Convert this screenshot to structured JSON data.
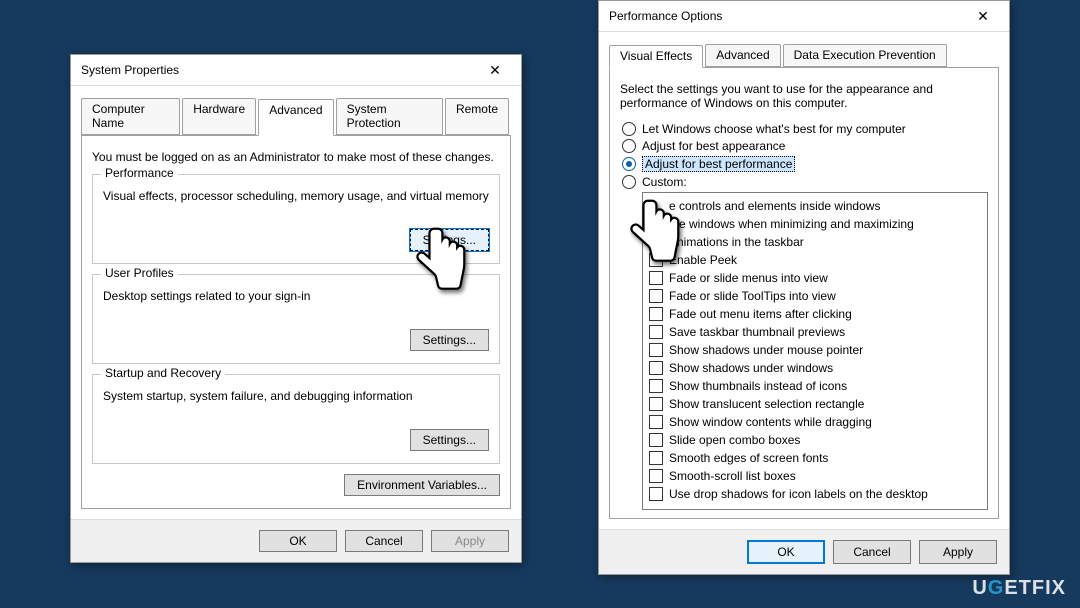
{
  "sysprops": {
    "title": "System Properties",
    "tabs": [
      "Computer Name",
      "Hardware",
      "Advanced",
      "System Protection",
      "Remote"
    ],
    "active_tab": 2,
    "instruction": "You must be logged on as an Administrator to make most of these changes.",
    "groups": {
      "performance": {
        "title": "Performance",
        "desc": "Visual effects, processor scheduling, memory usage, and virtual memory",
        "button": "Settings..."
      },
      "profiles": {
        "title": "User Profiles",
        "desc": "Desktop settings related to your sign-in",
        "button": "Settings..."
      },
      "startup": {
        "title": "Startup and Recovery",
        "desc": "System startup, system failure, and debugging information",
        "button": "Settings..."
      }
    },
    "env_button": "Environment Variables...",
    "ok": "OK",
    "cancel": "Cancel",
    "apply": "Apply"
  },
  "perfopts": {
    "title": "Performance Options",
    "tabs": [
      "Visual Effects",
      "Advanced",
      "Data Execution Prevention"
    ],
    "active_tab": 0,
    "instruction": "Select the settings you want to use for the appearance and performance of Windows on this computer.",
    "radios": [
      "Let Windows choose what's best for my computer",
      "Adjust for best appearance",
      "Adjust for best performance",
      "Custom:"
    ],
    "selected_radio": 2,
    "checks": [
      "Animate controls and elements inside windows",
      "Animate windows when minimizing and maximizing",
      "Animations in the taskbar",
      "Enable Peek",
      "Fade or slide menus into view",
      "Fade or slide ToolTips into view",
      "Fade out menu items after clicking",
      "Save taskbar thumbnail previews",
      "Show shadows under mouse pointer",
      "Show shadows under windows",
      "Show thumbnails instead of icons",
      "Show translucent selection rectangle",
      "Show window contents while dragging",
      "Slide open combo boxes",
      "Smooth edges of screen fonts",
      "Smooth-scroll list boxes",
      "Use drop shadows for icon labels on the desktop"
    ],
    "ok": "OK",
    "cancel": "Cancel",
    "apply": "Apply"
  },
  "watermark": {
    "u": "U",
    "g": "G",
    "rest": "ETFIX"
  }
}
